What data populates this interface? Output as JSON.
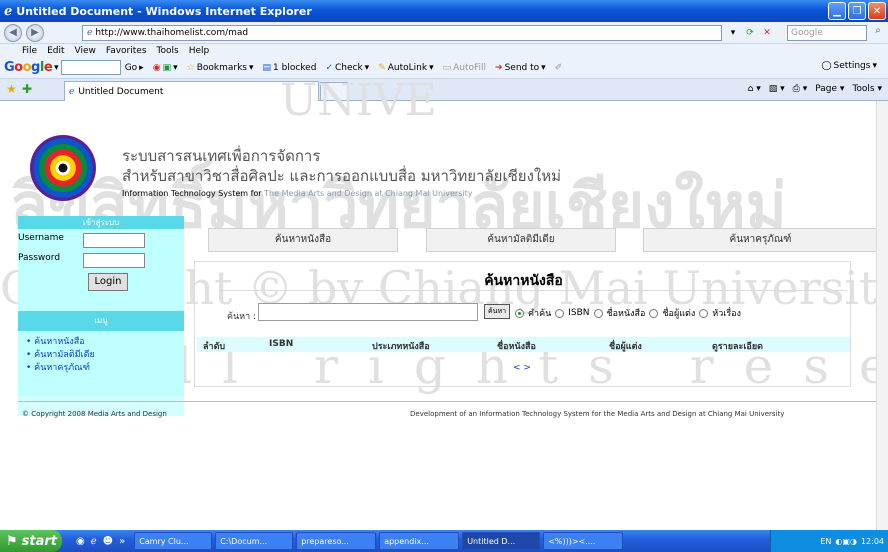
{
  "window": {
    "title": "Untitled Document - Windows Internet Explorer"
  },
  "address": {
    "url": "http://www.thaihomelist.com/mad",
    "search_placeholder": "Google"
  },
  "menu": [
    "File",
    "Edit",
    "View",
    "Favorites",
    "Tools",
    "Help"
  ],
  "google_toolbar": {
    "logo": "Google",
    "go": "Go",
    "bookmarks": "Bookmarks",
    "blocked": "1 blocked",
    "check": "Check",
    "autolink": "AutoLink",
    "autofill": "AutoFill",
    "sendto": "Send to",
    "settings": "Settings"
  },
  "tab": {
    "label": "Untitled Document"
  },
  "ie_tools": {
    "page": "Page",
    "tools": "Tools"
  },
  "header": {
    "line1": "ระบบสารสนเทศเพื่อการจัดการ",
    "line2": "สำหรับสาขาวิชาสื่อศิลปะ และการออกแบบสื่อ มหาวิทยาลัยเชียงใหม่",
    "line3_main": "Information Technology System for",
    "line3_sub": "The Media Arts and Design at Chiang Mai University"
  },
  "login": {
    "heading": "เข้าสู่ระบบ",
    "username_label": "Username",
    "password_label": "Password",
    "button": "Login"
  },
  "sidebar_menu": {
    "heading": "เมนู",
    "items": [
      "ค้นหาหนังสือ",
      "ค้นหามัลติมีเดีย",
      "ค้นหาครุภัณฑ์"
    ]
  },
  "top_tabs": [
    "ค้นหาหนังสือ",
    "ค้นหามัลติมีเดีย",
    "ค้นหาครุภัณฑ์"
  ],
  "search_panel": {
    "title": "ค้นหาหนังสือ",
    "label": "ค้นหา :",
    "button": "ค้นหา",
    "options": [
      "คำค้น",
      "ISBN",
      "ชื่อหนังสือ",
      "ชื่อผู้แต่ง",
      "หัวเรื่อง"
    ],
    "selected": 0,
    "columns": [
      "ลำดับ",
      "ISBN",
      "ประเภทหนังสือ",
      "ชื่อหนังสือ",
      "ชื่อผู้แต่ง",
      "ดูรายละเอียด"
    ],
    "pager": "< >"
  },
  "footer": {
    "left": "© Copyright 2008 Media Arts and Design",
    "right": "Development of an Information Technology System for the Media Arts and Design at Chiang Mai University"
  },
  "watermark": {
    "top": "UNIVE",
    "line1": "ลิขสิทธิ์มหาวิทยาลัยเชียงใหม่",
    "line2": "Copyright © by Chiang Mai University",
    "line3": "All rights reserved"
  },
  "taskbar": {
    "start": "start",
    "tasks": [
      "Camry Clu...",
      "C:\\Docum...",
      "prepareso...",
      "appendix...",
      "Untitled D...",
      "<%)))><...."
    ],
    "lang": "EN",
    "clock": "12:04"
  }
}
